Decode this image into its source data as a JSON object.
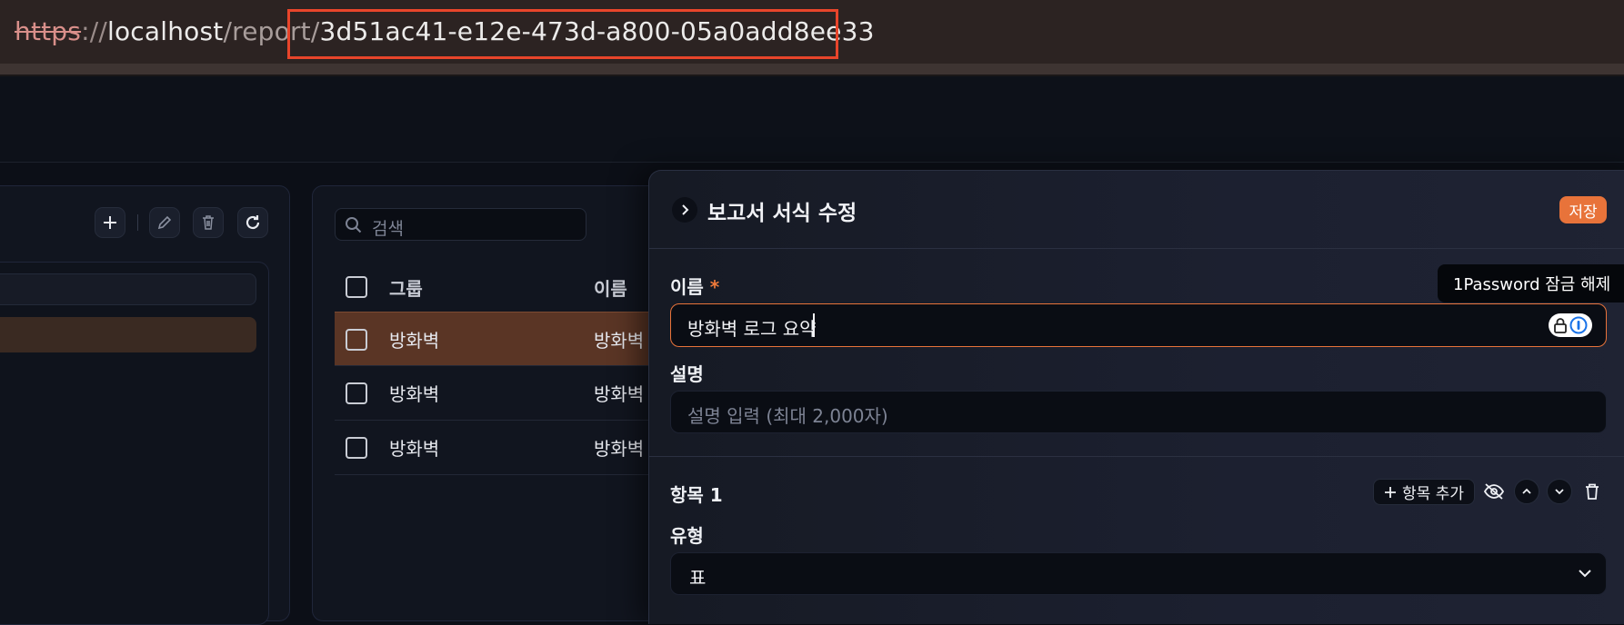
{
  "address_bar": {
    "scheme": "https",
    "separator": "://",
    "host": "localhost",
    "path": "/report/",
    "uuid": "3d51ac41-e12e-473d-a800-05a0add8ee33"
  },
  "left_panel": {
    "icons": [
      "plus-icon",
      "pencil-icon",
      "trash-icon",
      "refresh-icon"
    ]
  },
  "list": {
    "search_placeholder": "검색",
    "columns": [
      "그룹",
      "이름"
    ],
    "rows": [
      {
        "group": "방화벽",
        "name": "방화벽",
        "selected": true
      },
      {
        "group": "방화벽",
        "name": "방화벽",
        "selected": false
      },
      {
        "group": "방화벽",
        "name": "방화벽",
        "selected": false
      }
    ]
  },
  "drawer": {
    "title": "보고서 서식 수정",
    "save_label": "저장",
    "name_label": "이름",
    "required_mark": "*",
    "name_value": "방화벽 로그 요약",
    "tooltip": "1Password 잠금 해제",
    "desc_label": "설명",
    "desc_placeholder": "설명 입력 (최대 2,000자)",
    "section_title": "항목 1",
    "add_item_label": "항목 추가",
    "type_label": "유형",
    "type_value": "표"
  },
  "colors": {
    "accent": "#e8733a",
    "highlight_box": "#e8452b",
    "selected_row": "#5a3525"
  }
}
